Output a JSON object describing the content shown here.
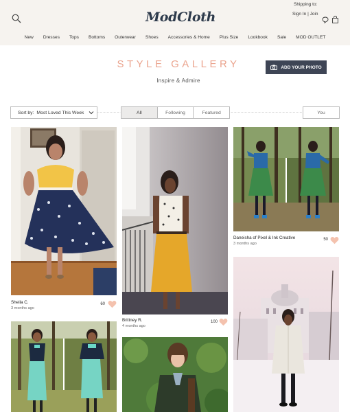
{
  "header": {
    "logo": "ModCloth",
    "shipping": "Shipping to:",
    "sign_in": "Sign In",
    "sep": "|",
    "join": "Join"
  },
  "nav": [
    "New",
    "Dresses",
    "Tops",
    "Bottoms",
    "Outerwear",
    "Shoes",
    "Accessories & Home",
    "Plus Size",
    "Lookbook",
    "Sale",
    "MOD OUTLET"
  ],
  "gallery": {
    "title": "STYLE GALLERY",
    "subtitle": "Inspire & Admire",
    "add_photo": "ADD YOUR PHOTO"
  },
  "filters": {
    "sort_label": "Sort by:",
    "sort_value": "Most Loved This Week",
    "tabs": [
      "All",
      "Following",
      "Featured"
    ],
    "active_tab": "All",
    "you": "You"
  },
  "cards": [
    {
      "name": "Sheila C.",
      "date": "3 months ago",
      "count": "60"
    },
    {
      "name": "Brittney R.",
      "date": "4 months ago",
      "count": "100"
    },
    {
      "name": "Daneisha of Pixel & Ink Creative",
      "date": "3 months ago",
      "count": "50"
    }
  ],
  "colors": {
    "accent": "#eba58f",
    "button": "#3e4555",
    "header_bg": "#f6f3ef",
    "heart": "#f4c2ae"
  }
}
